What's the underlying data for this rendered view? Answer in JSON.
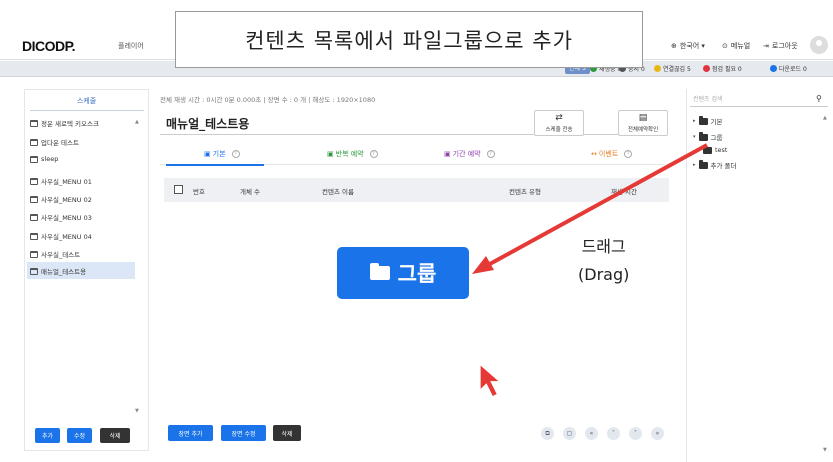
{
  "banner": {
    "text": "컨텐츠 목록에서 파일그룹으로 추가"
  },
  "header": {
    "logo": "DICODP.",
    "player_tab": "플레이어",
    "language": "한국어 ▾",
    "manual": "메뉴얼",
    "logout": "로그아웃"
  },
  "status": {
    "all": "전체 5",
    "items": [
      {
        "label": "재생중 0",
        "color": "#2e9a3e"
      },
      {
        "label": "중지 0",
        "color": "#555555"
      },
      {
        "label": "연결끊김 5",
        "color": "#e8b816"
      },
      {
        "label": "점검 필요 0",
        "color": "#e0353d"
      },
      {
        "label": "다운로드 0",
        "color": "#1a73e8"
      }
    ]
  },
  "left": {
    "title": "스케줄",
    "schedules": [
      "정운 새로텍 키오스크",
      "업다운 테스트",
      "sleep",
      "사우실_MENU 01",
      "사우실_MENU 02",
      "사우실_MENU 03",
      "사우실_MENU 04",
      "사우실_테스트",
      "매뉴얼_테스트용"
    ],
    "buttons": {
      "add": "추가",
      "edit": "수정",
      "delete": "삭제"
    }
  },
  "center": {
    "info": "전체 재생 시간 : 0시간 0분 0.000초   |   장면 수 : 0 개   |   해상도 : 1920×1080",
    "title": "매뉴얼_테스트용",
    "toolbar": {
      "send": "스케줄 전송",
      "check": "전체예약확인"
    },
    "tabs": [
      "기본",
      "반복 예약",
      "기간 예약",
      "이벤트"
    ],
    "columns": {
      "no": "번호",
      "count": "개체 수",
      "name": "컨텐츠 이름",
      "type": "컨텐츠 유형",
      "time": "재생 시간"
    },
    "footer": {
      "add_scene": "장면 추가",
      "edit_scene": "장면 수정",
      "delete": "삭제"
    }
  },
  "right": {
    "search_placeholder": "컨텐츠 검색",
    "tree": [
      "기본",
      "그룹",
      "test",
      "추가 폴더"
    ]
  },
  "drag": {
    "group_label": "그룹",
    "label_line1": "드래그",
    "label_line2": "(Drag)"
  }
}
